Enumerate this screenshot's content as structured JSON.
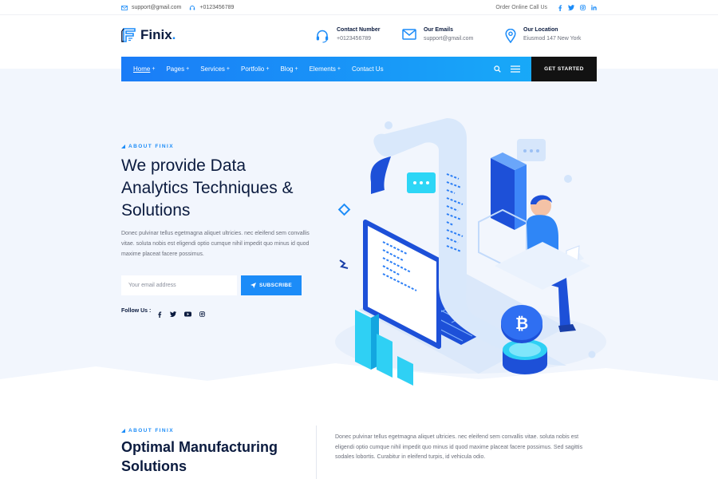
{
  "topbar": {
    "email": "support@gmail.com",
    "phone": "+0123456789",
    "order_text": "Order Online Call Us",
    "social_icons": [
      "facebook-icon",
      "twitter-icon",
      "instagram-icon",
      "linkedin-icon"
    ]
  },
  "brand": {
    "name": "Finix",
    "dot": ".",
    "accent": "#1c8cf8",
    "dark": "#0b1b3f"
  },
  "contact_info": [
    {
      "label": "Contact Number",
      "value": "+0123456789",
      "icon": "headset-icon"
    },
    {
      "label": "Our Emails",
      "value": "support@gmail.com",
      "icon": "mail-icon"
    },
    {
      "label": "Our Location",
      "value": "Eiusmod 147 New York",
      "icon": "location-pin-icon"
    }
  ],
  "nav": {
    "items": [
      {
        "label": "Home",
        "plus": "+"
      },
      {
        "label": "Pages",
        "plus": "+"
      },
      {
        "label": "Services",
        "plus": "+"
      },
      {
        "label": "Portfolio",
        "plus": "+"
      },
      {
        "label": "Blog",
        "plus": "+"
      },
      {
        "label": "Elements",
        "plus": "+"
      },
      {
        "label": "Contact Us",
        "plus": ""
      }
    ],
    "cta": "GET STARTED"
  },
  "hero": {
    "eyebrow": "ABOUT FINIX",
    "title_lines": [
      "We provide Data",
      "Analytics Techniques &",
      "Solutions"
    ],
    "description": "Donec pulvinar tellus egetmagna aliquet ultricies. nec eleifend sem convallis vitae. soluta nobis est eligendi optio cumque nihil impedit quo minus id quod maxime placeat facere possimus.",
    "email_placeholder": "Your email address",
    "subscribe_label": "SUBSCRIBE",
    "follow_label": "Follow Us :",
    "follow_icons": [
      "facebook-icon",
      "twitter-icon",
      "youtube-icon",
      "instagram-icon"
    ]
  },
  "section2": {
    "eyebrow": "ABOUT FINIX",
    "title_lines": [
      "Optimal Manufacturing",
      "Solutions"
    ],
    "text": "Donec pulvinar tellus egetmagna aliquet ultricies. nec eleifend sem convallis vitae. soluta nobis est eligendi optio cumque nihil impedit quo minus id quod maxime placeat facere possimus. Sed sagittis sodales lobortis. Curabitur in eleifend turpis, id vehicula odio."
  }
}
